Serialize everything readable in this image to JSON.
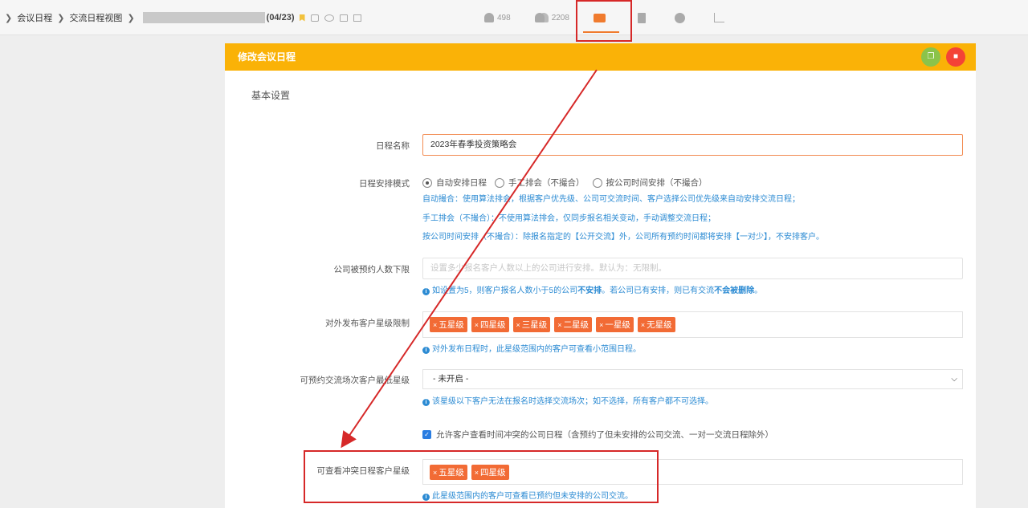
{
  "breadcrumb": {
    "item1": "会议日程",
    "item2": "交流日程视图",
    "count": "(04/23)"
  },
  "tabs": [
    {
      "label": "498",
      "icon": "user-icon"
    },
    {
      "label": "2208",
      "icon": "users-icon"
    },
    {
      "label": "",
      "icon": "calendar-icon"
    },
    {
      "label": "",
      "icon": "calculator-icon"
    },
    {
      "label": "",
      "icon": "person-icon"
    },
    {
      "label": "",
      "icon": "bar-chart-icon"
    }
  ],
  "panel": {
    "title": "修改会议日程",
    "section": "基本设置"
  },
  "fields": {
    "name": {
      "label": "日程名称",
      "value": "2023年春季投资策略会"
    },
    "mode": {
      "label": "日程安排模式",
      "options": [
        "自动安排日程",
        "手工排会（不撮合）",
        "按公司时间安排（不撮合）"
      ],
      "selected": 0,
      "help1": "自动撮合：使用算法排会，根据客户优先级、公司可交流时间、客户选择公司优先级来自动安排交流日程；",
      "help2": "手工排会（不撮合）：不使用算法排会，仅同步报名相关变动，手动调整交流日程；",
      "help3": "按公司时间安排（不撮合）：除报名指定的【公开交流】外，公司所有预约时间都将安排【一对少】，不安排客户。"
    },
    "min_booking": {
      "label": "公司被预约人数下限",
      "placeholder": "设置多少报名客户人数以上的公司进行安排。默认为：无限制。",
      "help_pre": "如设置为5，则客户报名人数小于5的公司",
      "help_b1": "不安排",
      "help_mid": "。若公司已有安排，则已有交流",
      "help_b2": "不会被删除",
      "help_end": "。"
    },
    "star_limit": {
      "label": "对外发布客户星级限制",
      "tags": [
        "五星级",
        "四星级",
        "三星级",
        "二星级",
        "一星级",
        "无星级"
      ],
      "help": "对外发布日程时，此星级范围内的客户可查看小范围日程。"
    },
    "min_star": {
      "label": "可预约交流场次客户最低星级",
      "value": "- 未开启 -",
      "help": "该星级以下客户无法在报名时选择交流场次；如不选择，所有客户都不可选择。"
    },
    "allow_conflict": {
      "checked": true,
      "label": "允许客户查看时间冲突的公司日程（含预约了但未安排的公司交流、一对一交流日程除外）"
    },
    "conflict_star": {
      "label": "可查看冲突日程客户星级",
      "tags": [
        "五星级",
        "四星级"
      ],
      "help": "此星级范围内的客户可查看已预约但未安排的公司交流。"
    }
  },
  "colors": {
    "header": "#fab207",
    "accent": "#f07b2e",
    "tag": "#f26b35",
    "help": "#2c8bd3",
    "annotation": "#d62828"
  }
}
